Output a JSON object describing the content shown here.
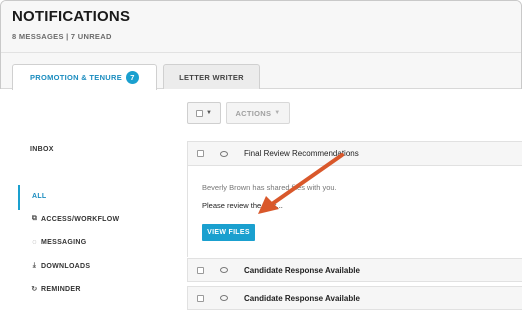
{
  "header": {
    "title": "NOTIFICATIONS",
    "subtitle": "8 MESSAGES | 7 UNREAD"
  },
  "tabs": [
    {
      "label": "PROMOTION & TENURE",
      "badge": "7",
      "active": true
    },
    {
      "label": "LETTER WRITER",
      "active": false
    }
  ],
  "toolbar": {
    "actions_label": "ACTIONS",
    "select_icon": "checkbox-dropdown-icon"
  },
  "sidebar": {
    "inbox": "INBOX",
    "items": [
      {
        "label": "ALL",
        "active": true
      },
      {
        "label": "ACCESS/WORKFLOW",
        "icon": "copy-icon"
      },
      {
        "label": "MESSAGING",
        "icon": "speech-bubble-icon"
      },
      {
        "label": "DOWNLOADS",
        "icon": "download-icon"
      },
      {
        "label": "REMINDER",
        "icon": "refresh-icon"
      }
    ]
  },
  "messages": [
    {
      "subject": "Final Review Recommendations",
      "unread": false
    },
    {
      "subject": "Candidate Response Available",
      "unread": true
    },
    {
      "subject": "Candidate Response Available",
      "unread": true
    }
  ],
  "expanded": {
    "shared_text": "Beverly Brown has shared files with you.",
    "body_text": "Please review the files...",
    "button_label": "VIEW FILES"
  },
  "colors": {
    "accent": "#1aa0cf",
    "annotation_arrow": "#d9582b"
  }
}
